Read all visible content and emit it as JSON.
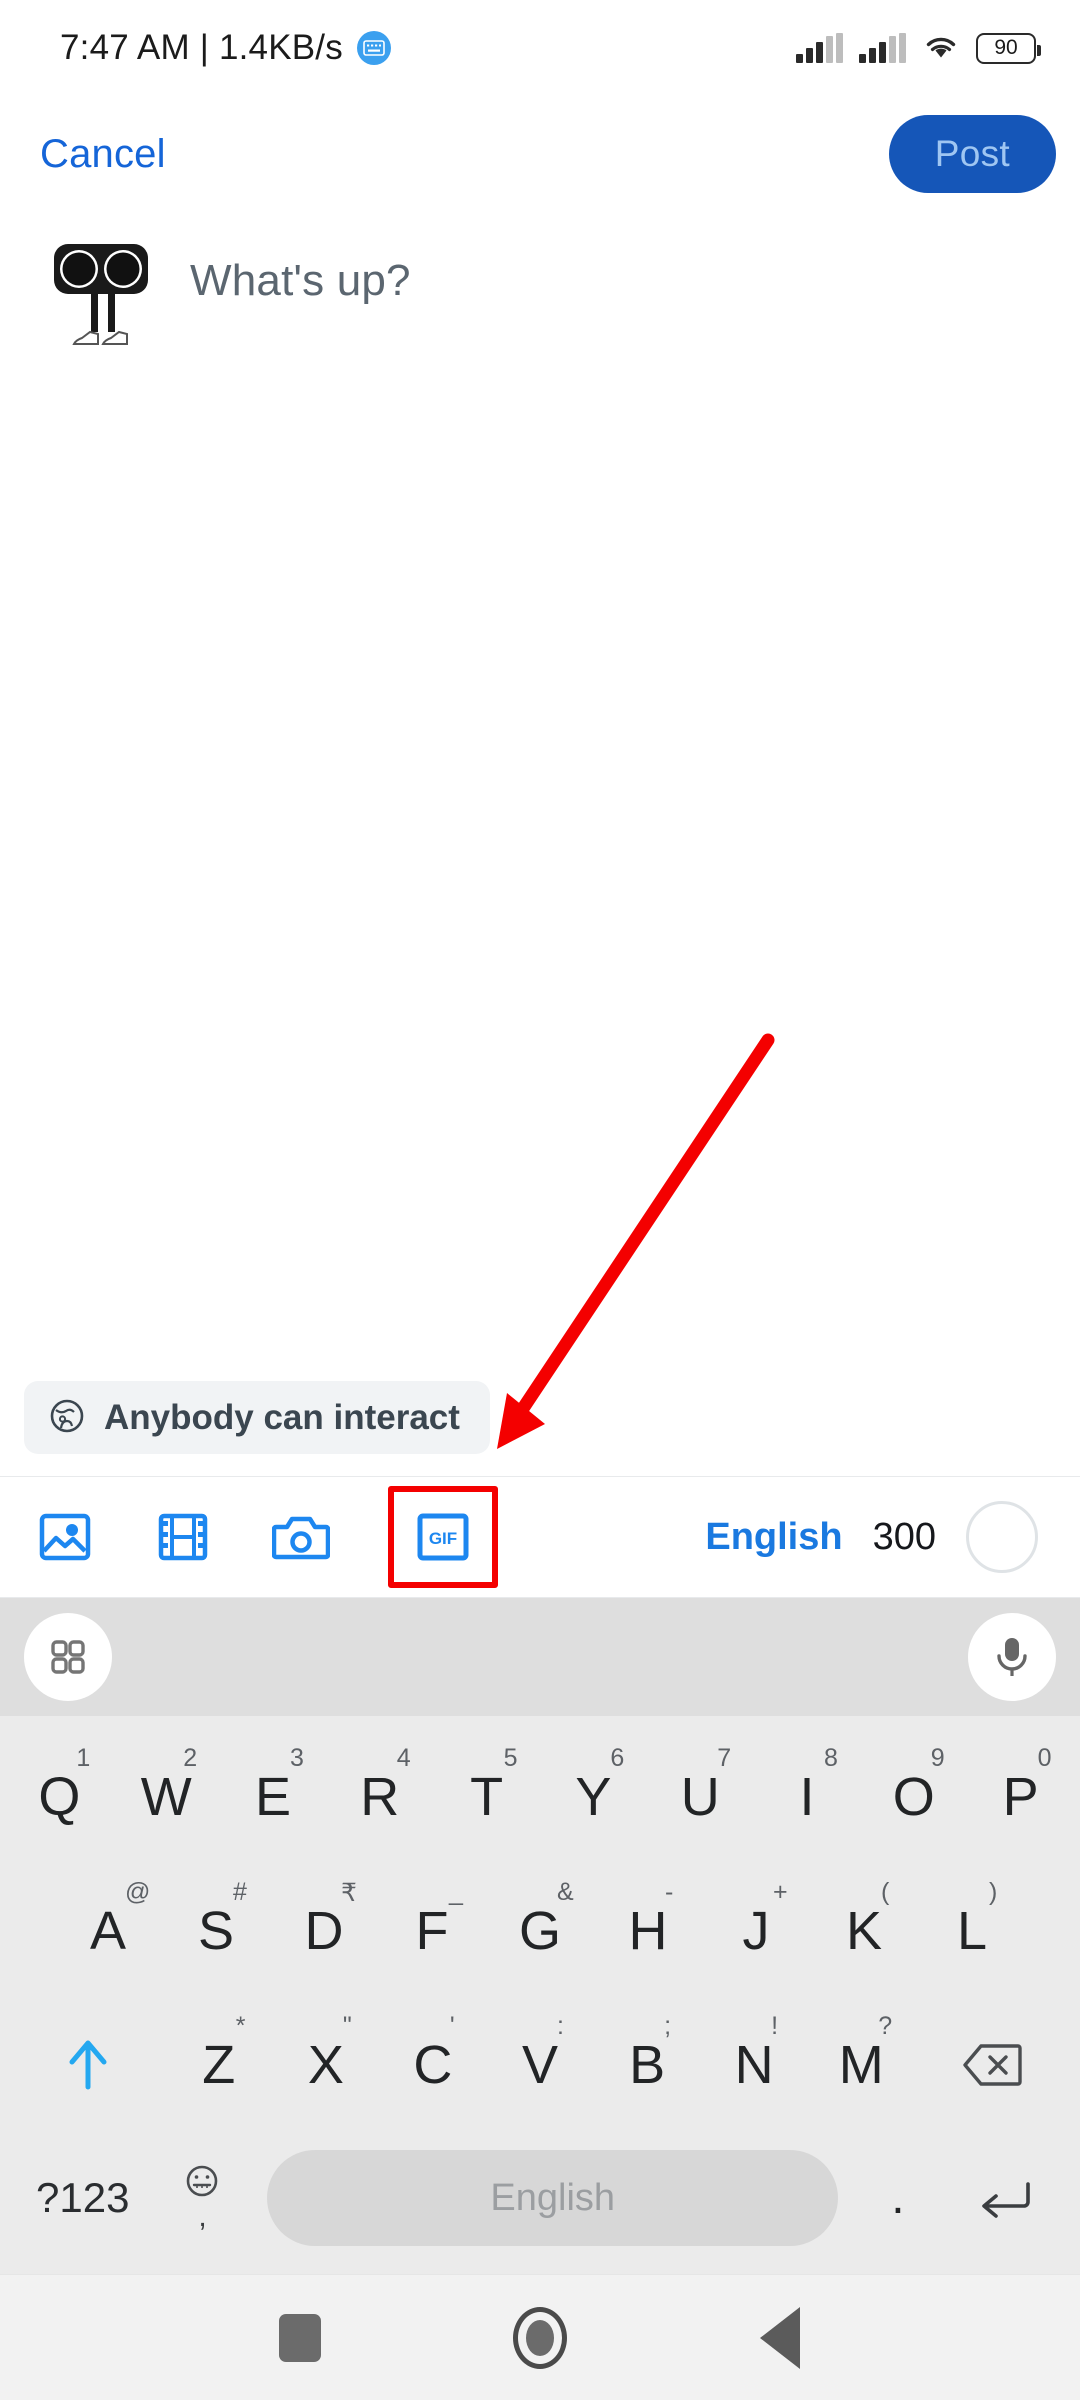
{
  "status_bar": {
    "clock": "7:47 AM | 1.4KB/s",
    "keyboard_badge_icon": "keyboard-icon",
    "signal_1_icon": "signal-bars-icon",
    "signal_2_icon": "signal-bars-icon",
    "wifi_icon": "wifi-icon",
    "battery_level": "90"
  },
  "top_nav": {
    "cancel_label": "Cancel",
    "post_label": "Post"
  },
  "composer": {
    "avatar_icon": "avatar-binoculars",
    "placeholder": "What's up?"
  },
  "audience": {
    "icon": "globe-icon",
    "label": "Anybody can interact"
  },
  "action_bar": {
    "media": [
      {
        "name": "image-icon",
        "label": ""
      },
      {
        "name": "video-icon",
        "label": ""
      },
      {
        "name": "camera-icon",
        "label": ""
      },
      {
        "name": "gif-icon",
        "label": "GIF"
      }
    ],
    "language_label": "English",
    "char_count": "300",
    "progress_ring_icon": "progress-ring-icon"
  },
  "annotation": {
    "highlight_target": "gif-icon",
    "arrow_color": "#f40000",
    "highlight_color": "#f40000"
  },
  "keyboard": {
    "toolbar": {
      "apps_icon": "grid-apps-icon",
      "mic_icon": "microphone-icon"
    },
    "row1": [
      {
        "main": "Q",
        "sup": "1"
      },
      {
        "main": "W",
        "sup": "2"
      },
      {
        "main": "E",
        "sup": "3"
      },
      {
        "main": "R",
        "sup": "4"
      },
      {
        "main": "T",
        "sup": "5"
      },
      {
        "main": "Y",
        "sup": "6"
      },
      {
        "main": "U",
        "sup": "7"
      },
      {
        "main": "I",
        "sup": "8"
      },
      {
        "main": "O",
        "sup": "9"
      },
      {
        "main": "P",
        "sup": "0"
      }
    ],
    "row2": [
      {
        "main": "A",
        "sup": "@"
      },
      {
        "main": "S",
        "sup": "#"
      },
      {
        "main": "D",
        "sup": "₹"
      },
      {
        "main": "F",
        "sup": "_"
      },
      {
        "main": "G",
        "sup": "&"
      },
      {
        "main": "H",
        "sup": "-"
      },
      {
        "main": "J",
        "sup": "+"
      },
      {
        "main": "K",
        "sup": "("
      },
      {
        "main": "L",
        "sup": ")"
      }
    ],
    "row3": [
      {
        "main": "Z",
        "sup": "*"
      },
      {
        "main": "X",
        "sup": "\""
      },
      {
        "main": "C",
        "sup": "'"
      },
      {
        "main": "V",
        "sup": ":"
      },
      {
        "main": "B",
        "sup": ";"
      },
      {
        "main": "N",
        "sup": "!"
      },
      {
        "main": "M",
        "sup": "?"
      }
    ],
    "shift_icon": "shift-up-arrow-icon",
    "backspace_icon": "backspace-icon",
    "row4": {
      "symbols_label": "?123",
      "emoji_icon": "emoji-face-icon",
      "emoji_sub": ",",
      "space_label": "English",
      "period_label": ".",
      "enter_icon": "enter-return-icon"
    }
  },
  "nav_bar": {
    "recents_icon": "recents-square-icon",
    "home_icon": "home-circle-icon",
    "back_icon": "back-triangle-icon"
  }
}
